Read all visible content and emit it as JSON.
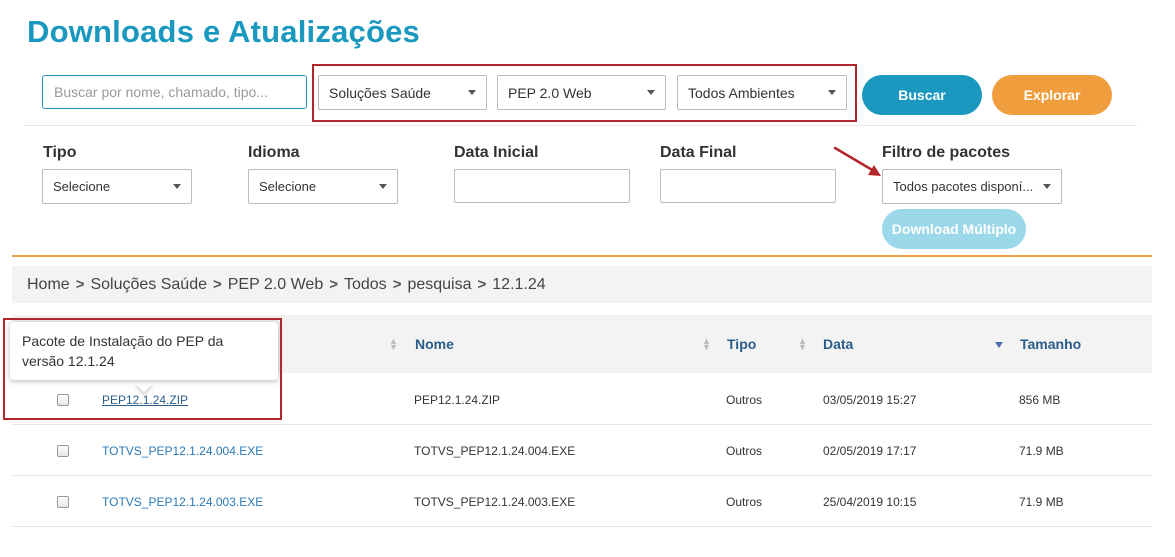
{
  "page": {
    "title": "Downloads e Atualizações"
  },
  "search": {
    "placeholder": "Buscar por nome, chamado, tipo...",
    "value": "",
    "selects": [
      "Soluções Saúde",
      "PEP 2.0 Web",
      "Todos Ambientes"
    ],
    "buscar_label": "Buscar",
    "explorar_label": "Explorar"
  },
  "filters": {
    "tipo_label": "Tipo",
    "tipo_value": "Selecione",
    "idioma_label": "Idioma",
    "idioma_value": "Selecione",
    "data_inicial_label": "Data Inicial",
    "data_final_label": "Data Final",
    "pacotes_label": "Filtro de pacotes",
    "pacotes_value": "Todos pacotes disponí...",
    "download_multiplo_label": "Download Múltiplo"
  },
  "breadcrumb": [
    "Home",
    "Soluções Saúde",
    "PEP 2.0 Web",
    "Todos",
    "pesquisa",
    "12.1.24"
  ],
  "table": {
    "columns": [
      "Nome",
      "Tipo",
      "Data",
      "Tamanho"
    ],
    "rows": [
      {
        "file": "PEP12.1.24.ZIP",
        "nome": "PEP12.1.24.ZIP",
        "tipo": "Outros",
        "data": "03/05/2019 15:27",
        "tamanho": "856 MB"
      },
      {
        "file": "TOTVS_PEP12.1.24.004.EXE",
        "nome": "TOTVS_PEP12.1.24.004.EXE",
        "tipo": "Outros",
        "data": "02/05/2019 17:17",
        "tamanho": "71.9 MB"
      },
      {
        "file": "TOTVS_PEP12.1.24.003.EXE",
        "nome": "TOTVS_PEP12.1.24.003.EXE",
        "tipo": "Outros",
        "data": "25/04/2019 10:15",
        "tamanho": "71.9 MB"
      }
    ]
  },
  "tooltip": {
    "text": "Pacote de Instalação do PEP da versão 12.1.24"
  },
  "colors": {
    "accent": "#1a98bf",
    "orange": "#ef9d3d",
    "highlight": "#b3262b",
    "link": "#2a7ab8"
  }
}
